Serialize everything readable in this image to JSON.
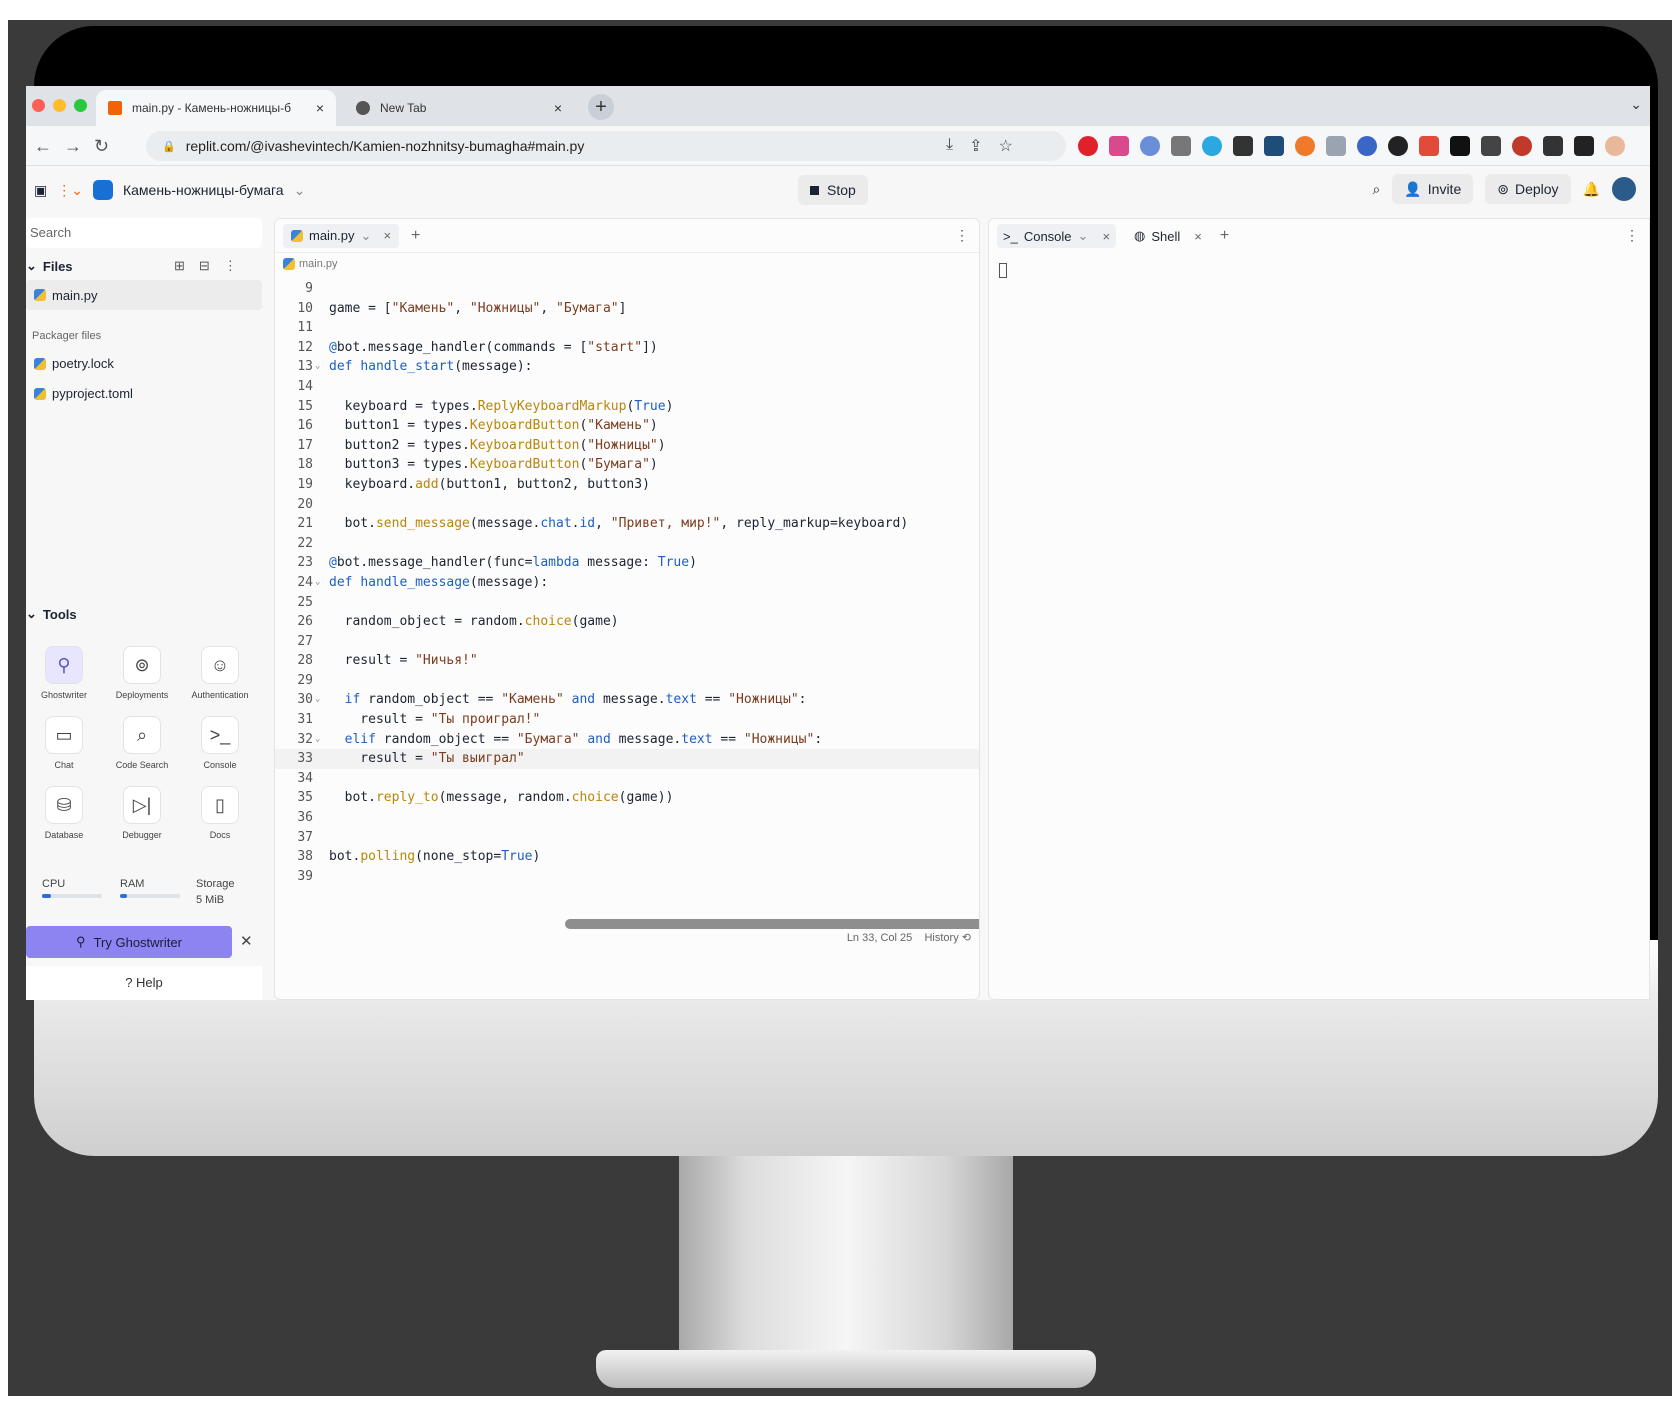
{
  "browser": {
    "tabs": [
      {
        "title": "main.py - Камень-ножницы-б",
        "close": "×"
      },
      {
        "title": "New Tab",
        "close": "×"
      }
    ],
    "new_tab": "+",
    "url": "replit.com/@ivashevintech/Kamien-nozhnitsy-bumagha#main.py",
    "colors": {
      "close": "#ff5f57",
      "minimize": "#febc2e",
      "zoom": "#28c840"
    }
  },
  "header": {
    "repl_name": "Камень-ножницы-бумага",
    "stop_label": "Stop",
    "invite_label": "Invite",
    "deploy_label": "Deploy"
  },
  "sidebar": {
    "search_placeholder": "Search",
    "files_title": "Files",
    "files": [
      "main.py"
    ],
    "packager_title": "Packager files",
    "packager_files": [
      "poetry.lock",
      "pyproject.toml"
    ],
    "tools_title": "Tools",
    "tools": [
      {
        "label": "Ghostwriter",
        "icon": "ghostwriter-icon"
      },
      {
        "label": "Deployments",
        "icon": "deployments-icon"
      },
      {
        "label": "Authentication",
        "icon": "user-icon"
      },
      {
        "label": "Chat",
        "icon": "chat-icon"
      },
      {
        "label": "Code Search",
        "icon": "search-icon"
      },
      {
        "label": "Console",
        "icon": "terminal-icon"
      },
      {
        "label": "Database",
        "icon": "database-icon"
      },
      {
        "label": "Debugger",
        "icon": "debugger-icon"
      },
      {
        "label": "Docs",
        "icon": "docs-icon"
      }
    ],
    "resources": {
      "cpu_label": "CPU",
      "ram_label": "RAM",
      "storage_label": "Storage",
      "storage_value": "5 MiB",
      "cpu_fraction": 0.15,
      "ram_fraction": 0.12
    },
    "ghostwriter_btn": "Try Ghostwriter",
    "help": "Help"
  },
  "editor": {
    "tab": "main.py",
    "breadcrumb": "main.py",
    "status": "Ln 33, Col 25",
    "history": "History",
    "current_line": 33
  },
  "console": {
    "tabs": [
      "Console",
      "Shell"
    ]
  }
}
